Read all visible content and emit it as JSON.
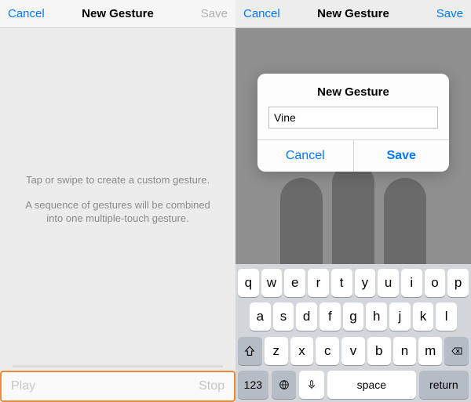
{
  "left": {
    "nav": {
      "cancel": "Cancel",
      "title": "New Gesture",
      "save": "Save"
    },
    "instruction_line1": "Tap or swipe to create a custom gesture.",
    "instruction_line2": "A sequence of gestures will be combined into one multiple-touch gesture.",
    "toolbar": {
      "play": "Play",
      "stop": "Stop"
    }
  },
  "right": {
    "nav": {
      "cancel": "Cancel",
      "title": "New Gesture",
      "save": "Save"
    },
    "modal": {
      "title": "New Gesture",
      "value": "Vine",
      "cancel": "Cancel",
      "save": "Save"
    },
    "keyboard": {
      "row1": [
        "q",
        "w",
        "e",
        "r",
        "t",
        "y",
        "u",
        "i",
        "o",
        "p"
      ],
      "row2": [
        "a",
        "s",
        "d",
        "f",
        "g",
        "h",
        "j",
        "k",
        "l"
      ],
      "row3": [
        "z",
        "x",
        "c",
        "v",
        "b",
        "n",
        "m"
      ],
      "num": "123",
      "space": "space",
      "return": "return"
    }
  }
}
